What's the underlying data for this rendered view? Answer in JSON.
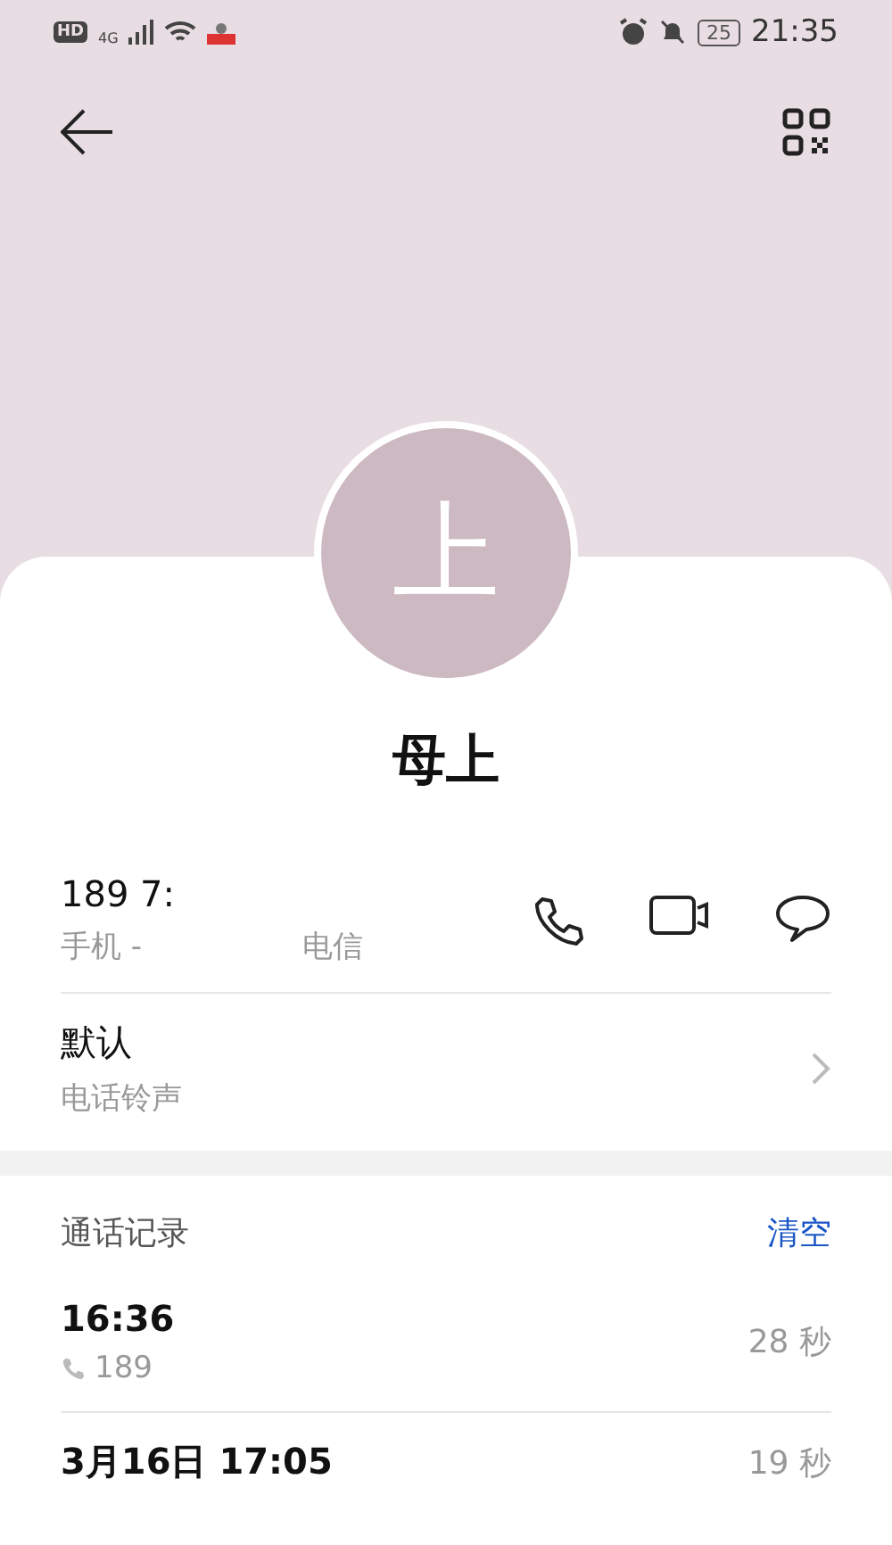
{
  "status_bar": {
    "left": [
      "HD",
      "4G"
    ],
    "battery": "25",
    "time": "21:35"
  },
  "avatar": {
    "letter": "上"
  },
  "name": "母上",
  "phone": {
    "number": "189 7:",
    "type": "手机 -",
    "carrier": "电信"
  },
  "ringtone": {
    "title": "默认",
    "subtitle": "电话铃声"
  },
  "call_log": {
    "title": "通话记录",
    "clear": "清空",
    "entries": [
      {
        "time": "16:36",
        "number": "189",
        "duration": "28 秒"
      },
      {
        "time": "3月16日 17:05",
        "duration": "19 秒"
      }
    ]
  }
}
